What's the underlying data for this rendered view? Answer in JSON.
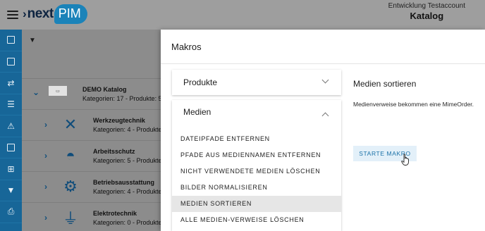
{
  "header": {
    "menu_icon": "hamburger-menu-icon",
    "logo": {
      "prefix": "next",
      "suffix": "PIM"
    },
    "account_name": "Entwicklung Testaccount",
    "app_name": "Katalog",
    "colors": {
      "brand_blue": "#1b83b9",
      "brand_navy": "#0d2340"
    }
  },
  "rail": {
    "icons": [
      "product-icon",
      "catalog-icon",
      "shuffle-icon",
      "list-icon",
      "warning-icon",
      "document-icon",
      "hierarchy-icon",
      "filter-icon",
      "print-icon"
    ],
    "color": "#176698"
  },
  "background": {
    "root": {
      "title": "DEMO Katalog",
      "subtitle": "Kategorien: 17 - Produkte: 5"
    },
    "rows": [
      {
        "title": "Werkzeugtechnik",
        "subtitle": "Kategorien: 4 - Produkte",
        "icon": "tools-icon"
      },
      {
        "title": "Arbeitsschutz",
        "subtitle": "Kategorien: 5 - Produkte",
        "icon": "hardhat-icon"
      },
      {
        "title": "Betriebsausstattung",
        "subtitle": "Kategorien: 4 - Produkte",
        "icon": "gears-icon"
      },
      {
        "title": "Elektrotechnik",
        "subtitle": "Kategorien: 0 - Produkte",
        "icon": "plug-icon"
      }
    ]
  },
  "dialog": {
    "title": "Makros",
    "panels": {
      "products": {
        "label": "Produkte"
      },
      "media": {
        "label": "Medien",
        "items": [
          "DATEIPFADE ENTFERNEN",
          "PFADE AUS MEDIENNAMEN ENTFERNEN",
          "NICHT VERWENDETE MEDIEN LÖSCHEN",
          "BILDER NORMALISIEREN",
          "MEDIEN SORTIEREN",
          "ALLE MEDIEN-VERWEISE LÖSCHEN"
        ],
        "active_item": "MEDIEN SORTIEREN"
      }
    },
    "detail": {
      "title": "Medien sortieren",
      "description": "Medienverweise bekommen eine MimeOrder.",
      "button": "STARTE MAKRO",
      "button_color": "#1b72a8"
    }
  }
}
